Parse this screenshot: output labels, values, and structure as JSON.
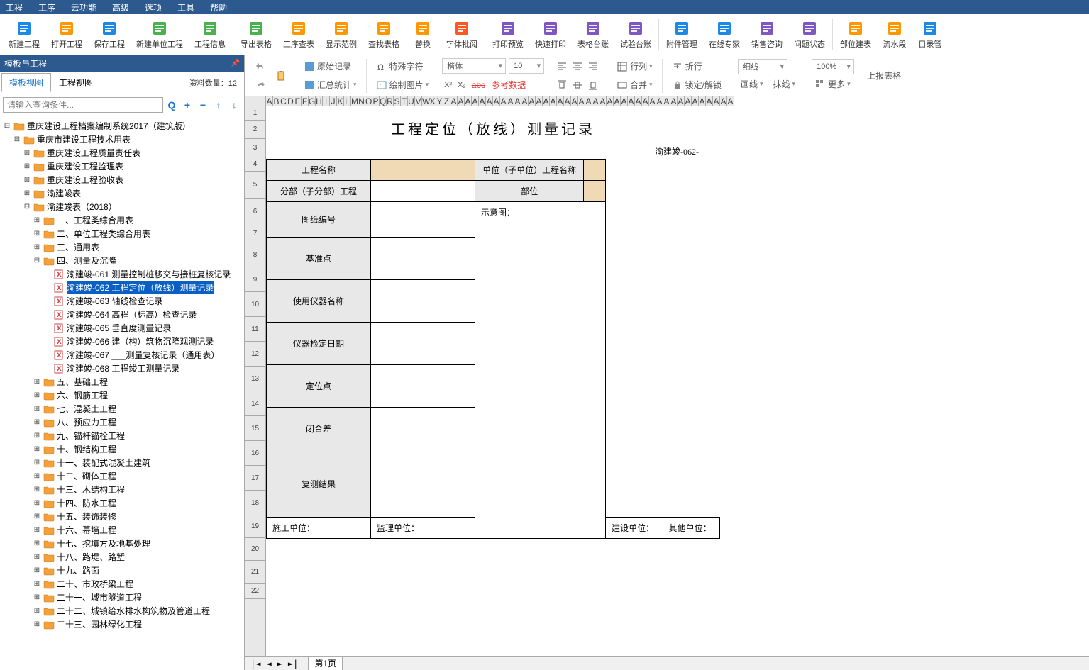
{
  "menu": [
    "工程",
    "工序",
    "云功能",
    "高级",
    "选项",
    "工具",
    "帮助"
  ],
  "toolbar": [
    {
      "name": "new-project",
      "label": "新建工程",
      "color": "#1e88e5"
    },
    {
      "name": "open-project",
      "label": "打开工程",
      "color": "#ff9800"
    },
    {
      "name": "save-project",
      "label": "保存工程",
      "color": "#1e88e5"
    },
    {
      "name": "new-unit",
      "label": "新建单位工程",
      "color": "#4caf50"
    },
    {
      "name": "project-info",
      "label": "工程信息",
      "color": "#4caf50"
    },
    {
      "name": "export-table",
      "label": "导出表格",
      "color": "#4caf50"
    },
    {
      "name": "seq-search",
      "label": "工序查表",
      "color": "#ff9800"
    },
    {
      "name": "show-example",
      "label": "显示范例",
      "color": "#ff9800"
    },
    {
      "name": "find-table",
      "label": "查找表格",
      "color": "#ff9800"
    },
    {
      "name": "replace",
      "label": "替换",
      "color": "#ff9800"
    },
    {
      "name": "font-approve",
      "label": "字体批阅",
      "color": "#ff5722"
    },
    {
      "name": "print-preview",
      "label": "打印预览",
      "color": "#7e57c2"
    },
    {
      "name": "quick-print",
      "label": "快速打印",
      "color": "#7e57c2"
    },
    {
      "name": "table-ledger",
      "label": "表格台账",
      "color": "#7e57c2"
    },
    {
      "name": "test-ledger",
      "label": "试验台账",
      "color": "#7e57c2"
    },
    {
      "name": "attachment",
      "label": "附件管理",
      "color": "#1e88e5"
    },
    {
      "name": "online-expert",
      "label": "在线专家",
      "color": "#1e88e5"
    },
    {
      "name": "sales",
      "label": "销售咨询",
      "color": "#7e57c2"
    },
    {
      "name": "issue-status",
      "label": "问题状态",
      "color": "#7e57c2"
    },
    {
      "name": "part-build",
      "label": "部位建表",
      "color": "#ff9800"
    },
    {
      "name": "pipeline",
      "label": "流水段",
      "color": "#ff9800"
    },
    {
      "name": "dir-manage",
      "label": "目录管",
      "color": "#1e88e5"
    }
  ],
  "sidebar": {
    "title": "模板与工程",
    "tabs": [
      "模板视图",
      "工程视图"
    ],
    "count": "资料数量：12",
    "searchPlaceholder": "请输入查询条件..."
  },
  "tree": {
    "root": "重庆建设工程档案编制系统2017（建筑版）",
    "n1": "重庆市建设工程技术用表",
    "n1_1": "重庆建设工程质量责任表",
    "n1_2": "重庆建设工程监理表",
    "n1_3": "重庆建设工程验收表",
    "n1_4": "渝建竣表",
    "n1_5": "渝建竣表（2018）",
    "c1": "一、工程类综合用表",
    "c2": "二、单位工程类综合用表",
    "c3": "三、通用表",
    "c4": "四、测量及沉降",
    "l61": "渝建竣-061 测量控制桩移交与接桩复核记录",
    "l62": "渝建竣-062 工程定位（放线）测量记录",
    "l63": "渝建竣-063 轴线检查记录",
    "l64": "渝建竣-064 高程（标高）检查记录",
    "l65": "渝建竣-065 垂直度测量记录",
    "l66": "渝建竣-066 建（构）筑物沉降观测记录",
    "l67": "渝建竣-067 ___测量复核记录（通用表）",
    "l68": "渝建竣-068 工程竣工测量记录",
    "c5": "五、基础工程",
    "c6": "六、钢筋工程",
    "c7": "七、混凝土工程",
    "c8": "八、预应力工程",
    "c9": "九、锚杆锚栓工程",
    "c10": "十、钢结构工程",
    "c11": "十一、装配式混凝土建筑",
    "c12": "十二、砌体工程",
    "c13": "十三、木结构工程",
    "c14": "十四、防水工程",
    "c15": "十五、装饰装修",
    "c16": "十六、幕墙工程",
    "c17": "十七、挖填方及地基处理",
    "c18": "十八、路堤、路堑",
    "c19": "十九、路面",
    "c20": "二十、市政桥梁工程",
    "c21": "二十一、城市隧道工程",
    "c22": "二十二、城镇给水排水构筑物及管道工程",
    "c23": "二十三、园林绿化工程"
  },
  "ribbon": {
    "orig": "原始记录",
    "special": "特殊字符",
    "font": "楷体",
    "size": "10",
    "summary": "汇总统计",
    "draw": "绘制图片",
    "ref": "参考数据",
    "rc": "行列",
    "fold": "折行",
    "merge": "合并",
    "lock": "锁定/解锁",
    "line1": "细线",
    "line2": "画线",
    "line3": "抹线",
    "zoom": "100%",
    "report": "上报表格",
    "more": "更多"
  },
  "doc": {
    "title": "工程定位（放线）测量记录",
    "num": "渝建竣-062-",
    "r1a": "工程名称",
    "r1b": "单位（子单位）工程名称",
    "r2a": "分部（子分部）工程",
    "r2b": "部位",
    "r3": "图纸编号",
    "r3b": "示意图：",
    "r4": "基准点",
    "r5": "使用仪器名称",
    "r6": "仪器检定日期",
    "r7": "定位点",
    "r8": "闭合差",
    "r9": "复测结果",
    "f1": "施工单位：",
    "f2": "监理单位：",
    "f3": "建设单位：",
    "f4": "其他单位："
  },
  "status": {
    "page": "第1页"
  }
}
